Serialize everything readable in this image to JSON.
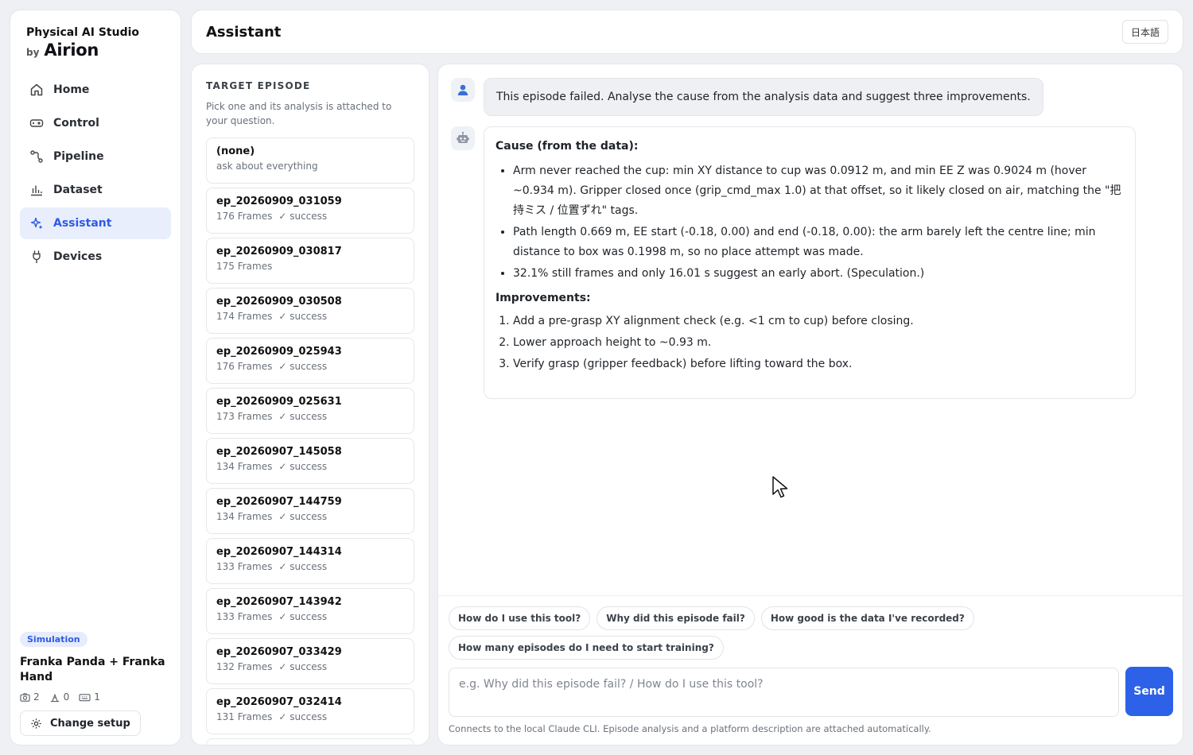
{
  "brand": {
    "title": "Physical AI Studio",
    "by": "by",
    "logo": "Airion"
  },
  "nav": {
    "items": [
      {
        "label": "Home",
        "icon": "home-icon",
        "active": false
      },
      {
        "label": "Control",
        "icon": "gamepad-icon",
        "active": false
      },
      {
        "label": "Pipeline",
        "icon": "pipeline-icon",
        "active": false
      },
      {
        "label": "Dataset",
        "icon": "bar-chart-icon",
        "active": false
      },
      {
        "label": "Assistant",
        "icon": "sparkle-icon",
        "active": true
      },
      {
        "label": "Devices",
        "icon": "plug-icon",
        "active": false
      }
    ]
  },
  "setup": {
    "badge": "Simulation",
    "robot": "Franka Panda + Franka Hand",
    "cameras": "2",
    "robots": "0",
    "controllers": "1",
    "change_label": "Change setup"
  },
  "header": {
    "title": "Assistant",
    "lang_button": "日本語"
  },
  "episodes": {
    "heading": "TARGET EPISODE",
    "help": "Pick one and its analysis is attached to your question.",
    "items": [
      {
        "name": "(none)",
        "frames": "ask about everything",
        "status": ""
      },
      {
        "name": "ep_20260909_031059",
        "frames": "176 Frames",
        "status": "✓ success"
      },
      {
        "name": "ep_20260909_030817",
        "frames": "175 Frames",
        "status": ""
      },
      {
        "name": "ep_20260909_030508",
        "frames": "174 Frames",
        "status": "✓ success"
      },
      {
        "name": "ep_20260909_025943",
        "frames": "176 Frames",
        "status": "✓ success"
      },
      {
        "name": "ep_20260909_025631",
        "frames": "173 Frames",
        "status": "✓ success"
      },
      {
        "name": "ep_20260907_145058",
        "frames": "134 Frames",
        "status": "✓ success"
      },
      {
        "name": "ep_20260907_144759",
        "frames": "134 Frames",
        "status": "✓ success"
      },
      {
        "name": "ep_20260907_144314",
        "frames": "133 Frames",
        "status": "✓ success"
      },
      {
        "name": "ep_20260907_143942",
        "frames": "133 Frames",
        "status": "✓ success"
      },
      {
        "name": "ep_20260907_033429",
        "frames": "132 Frames",
        "status": "✓ success"
      },
      {
        "name": "ep_20260907_032414",
        "frames": "131 Frames",
        "status": "✓ success"
      }
    ]
  },
  "chat": {
    "user_message": "This episode failed. Analyse the cause from the analysis data and suggest three improvements.",
    "reply": {
      "cause_heading": "Cause (from the data):",
      "cause_points": [
        "Arm never reached the cup: min XY distance to cup was 0.0912 m, and min EE Z was 0.9024 m (hover ~0.934 m). Gripper closed once (grip_cmd_max 1.0) at that offset, so it likely closed on air, matching the \"把持ミス / 位置ずれ\" tags.",
        "Path length 0.669 m, EE start (-0.18, 0.00) and end (-0.18, 0.00): the arm barely left the centre line; min distance to box was 0.1998 m, so no place attempt was made.",
        "32.1% still frames and only 16.01 s suggest an early abort. (Speculation.)"
      ],
      "improvements_heading": "Improvements:",
      "improvements": [
        "Add a pre-grasp XY alignment check (e.g. <1 cm to cup) before closing.",
        "Lower approach height to ~0.93 m.",
        "Verify grasp (gripper feedback) before lifting toward the box."
      ]
    },
    "suggestions": [
      "How do I use this tool?",
      "Why did this episode fail?",
      "How good is the data I've recorded?",
      "How many episodes do I need to start training?"
    ],
    "input_placeholder": "e.g. Why did this episode fail? / How do I use this tool?",
    "send_label": "Send",
    "footnote": "Connects to the local Claude CLI. Episode analysis and a platform description are attached automatically."
  },
  "colors": {
    "accent": "#2d62e8",
    "active_nav_bg": "#e9eefc"
  }
}
